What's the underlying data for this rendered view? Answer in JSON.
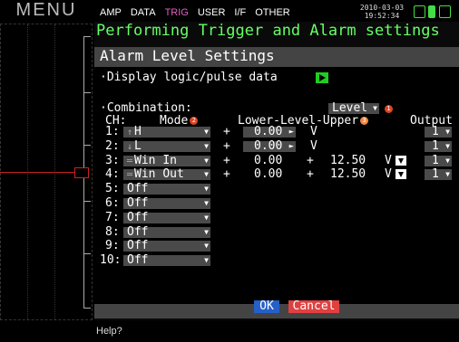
{
  "menu_label": "MENU",
  "tabs": [
    "AMP",
    "DATA",
    "TRIG",
    "USER",
    "I/F",
    "OTHER"
  ],
  "active_tab": "TRIG",
  "clock": {
    "date": "2010-03-03",
    "time": "19:52:34"
  },
  "page_title": "Performing Trigger and Alarm settings",
  "panel_title": "Alarm Level Settings",
  "display_label": "·Display logic/pulse data",
  "combination_label": "·Combination:",
  "combination_value": "Level",
  "headers": {
    "ch": "CH:",
    "mode": "Mode",
    "lower_upper": "Lower-Level-Upper",
    "output": "Output"
  },
  "badges": {
    "combination": "1",
    "mode": "2",
    "lower_upper": "3"
  },
  "rows": [
    {
      "ch": "1:",
      "mode": "H",
      "icon": "rising-edge",
      "sign": "+",
      "lower": "0.00",
      "lower_arrow": "►",
      "unit": "V",
      "upper_sign": "",
      "upper": "",
      "upper_unit": "",
      "output": "1"
    },
    {
      "ch": "2:",
      "mode": "L",
      "icon": "falling-edge",
      "sign": "+",
      "lower": "0.00",
      "lower_arrow": "►",
      "unit": "V",
      "upper_sign": "",
      "upper": "",
      "upper_unit": "",
      "output": "1"
    },
    {
      "ch": "3:",
      "mode": "Win In",
      "icon": "window",
      "sign": "+",
      "lower": "0.00",
      "lower_arrow": "",
      "unit": "",
      "upper_sign": "+",
      "upper": "12.50",
      "upper_unit": "V",
      "output": "1"
    },
    {
      "ch": "4:",
      "mode": "Win Out",
      "icon": "window",
      "sign": "+",
      "lower": "0.00",
      "lower_arrow": "",
      "unit": "",
      "upper_sign": "+",
      "upper": "12.50",
      "upper_unit": "V",
      "output": "1"
    },
    {
      "ch": "5:",
      "mode": "Off"
    },
    {
      "ch": "6:",
      "mode": "Off"
    },
    {
      "ch": "7:",
      "mode": "Off"
    },
    {
      "ch": "8:",
      "mode": "Off"
    },
    {
      "ch": "9:",
      "mode": "Off"
    },
    {
      "ch": "10:",
      "mode": "Off"
    }
  ],
  "ok_label": "OK",
  "cancel_label": "Cancel",
  "help_text": "Help?",
  "colors": {
    "title_green": "#66ff66",
    "ok_blue": "#2460c8",
    "cancel_red": "#e04040",
    "active_tab": "#e060c0"
  }
}
